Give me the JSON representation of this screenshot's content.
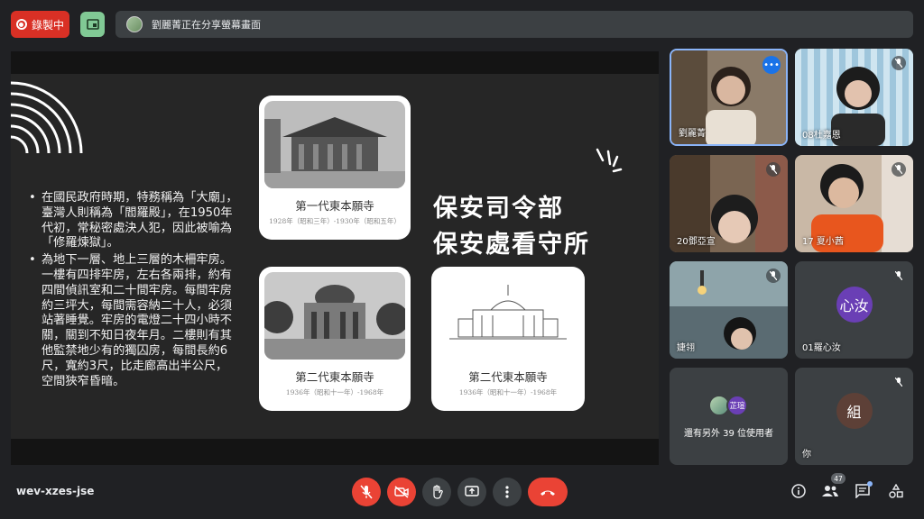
{
  "topbar": {
    "record_label": "錄製中",
    "presenting_text": "劉麗菁正在分享螢幕畫面"
  },
  "slide": {
    "bullets": [
      "在國民政府時期，特務稱為「大廟」，臺灣人則稱為「閻羅殿」，在1950年代初，常秘密處決人犯，因此被喻為「修羅煉獄」。",
      "為地下一層、地上三層的木柵牢房。一樓有四排牢房，左右各兩排，約有四間偵訊室和二十間牢房。每間牢房約三坪大，每間需容納二十人，必須站著睡覺。牢房的電燈二十四小時不關，關到不知日夜年月。二樓則有其他監禁地少有的獨囚房，每間長約6尺，寬約3尺，比走廊高出半公尺，空間狹窄昏暗。"
    ],
    "title_line1": "保安司令部",
    "title_line2": "保安處看守所",
    "cards": [
      {
        "caption": "第一代東本願寺",
        "sub": "1928年（昭和三年）-1930年（昭和五年）"
      },
      {
        "caption": "第二代東本願寺",
        "sub": "1936年（昭和十一年）-1968年"
      },
      {
        "caption": "第二代東本願寺",
        "sub": "1936年（昭和十一年）-1968年"
      }
    ]
  },
  "participants": [
    {
      "name": "劉麗菁"
    },
    {
      "name": "08杜嘉恩"
    },
    {
      "name": "20鄧亞宣"
    },
    {
      "name": "17 夏小茜"
    },
    {
      "name": "婕翎"
    },
    {
      "name": "01羅心汝",
      "initials": "心汝"
    },
    {
      "others_text": "還有另外 39 位使用者",
      "avatar2": "芷瑄"
    },
    {
      "name": "你",
      "initials": "組"
    }
  ],
  "bottombar": {
    "meeting_code": "wev-xzes-jse",
    "people_count": "47"
  },
  "colors": {
    "accent_red": "#ea4335",
    "bar_bg": "#3c4043",
    "bg": "#202124",
    "speaker_border": "#8ab4f8"
  }
}
